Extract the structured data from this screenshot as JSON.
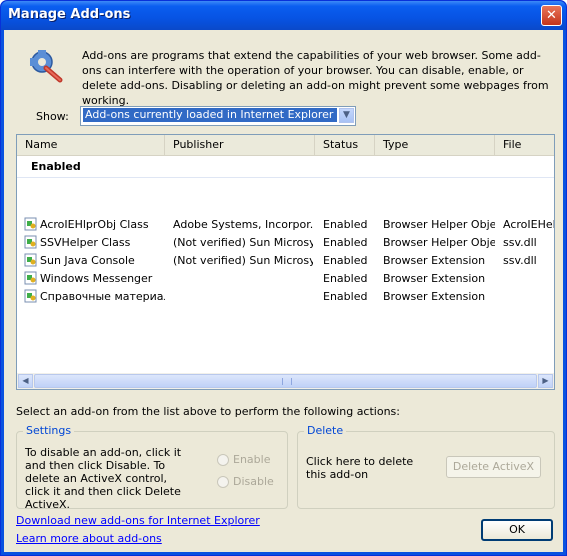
{
  "window": {
    "title": "Manage Add-ons",
    "close": "✕"
  },
  "intro": "Add-ons are programs that extend the capabilities of your web browser. Some add-ons can interfere with the operation of your browser. You can disable, enable, or delete add-ons. Disabling or deleting an add-on might prevent some webpages from working.",
  "show": {
    "label": "Show:",
    "selected": "Add-ons currently loaded in Internet Explorer"
  },
  "table": {
    "columns": [
      "Name",
      "Publisher",
      "Status",
      "Type",
      "File"
    ],
    "group": "Enabled",
    "rows": [
      {
        "name": "AcroIEHlprObj Class",
        "publisher": "Adobe Systems, Incorpor...",
        "status": "Enabled",
        "type": "Browser Helper Object",
        "file": "AcroIEHelp"
      },
      {
        "name": "SSVHelper Class",
        "publisher": "(Not verified) Sun Microsy...",
        "status": "Enabled",
        "type": "Browser Helper Object",
        "file": "ssv.dll"
      },
      {
        "name": "Sun Java Console",
        "publisher": "(Not verified) Sun Microsy...",
        "status": "Enabled",
        "type": "Browser Extension",
        "file": "ssv.dll"
      },
      {
        "name": "Windows Messenger",
        "publisher": "",
        "status": "Enabled",
        "type": "Browser Extension",
        "file": ""
      },
      {
        "name": "Справочные материалы",
        "publisher": "",
        "status": "Enabled",
        "type": "Browser Extension",
        "file": ""
      }
    ]
  },
  "actions_label": "Select an add-on from the list above to perform the following actions:",
  "settings": {
    "title": "Settings",
    "text": "To disable an add-on, click it and then click Disable. To delete an ActiveX control, click it and then click Delete ActiveX.",
    "enable": "Enable",
    "disable": "Disable"
  },
  "delete": {
    "title": "Delete",
    "text": "Click here to delete this add-on",
    "button": "Delete ActiveX"
  },
  "links": {
    "download": "Download new add-ons for Internet Explorer",
    "learn": "Learn more about add-ons"
  },
  "ok": "OK"
}
